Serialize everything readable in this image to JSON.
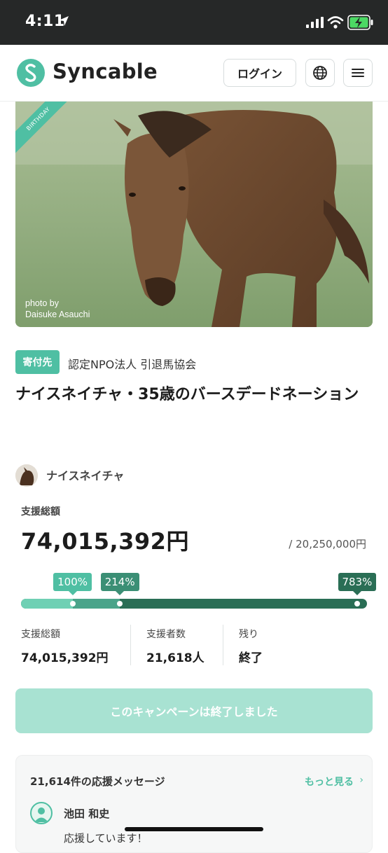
{
  "status_bar": {
    "time": "4:11"
  },
  "header": {
    "brand": "Syncable",
    "login_label": "ログイン"
  },
  "hero": {
    "ribbon_text": "BIRTHDAY",
    "credit_line1": "photo by",
    "credit_line2": "Daisuke Asauchi"
  },
  "campaign": {
    "recipient_tag": "寄付先",
    "recipient_org": "認定NPO法人 引退馬協会",
    "title": "ナイスネイチャ・35歳のバースデードネーション",
    "owner_name": "ナイスネイチャ",
    "total_label": "支援総額",
    "total_amount": "74,015,392円",
    "goal": "/ 20,250,000円",
    "milestones": [
      {
        "label": "100%",
        "fraction": 0.128
      },
      {
        "label": "214%",
        "fraction": 0.273
      },
      {
        "label": "783%",
        "fraction": 1.0
      }
    ],
    "stats": [
      {
        "label": "支援総額",
        "value": "74,015,392円"
      },
      {
        "label": "支援者数",
        "value": "21,618人"
      },
      {
        "label": "残り",
        "value": "終了"
      }
    ],
    "ended_button": "このキャンペーンは終了しました"
  },
  "messages": {
    "count_label": "21,614件の応援メッセージ",
    "more_label": "もっと見る",
    "first": {
      "name": "池田 和史",
      "text": "応援しています！"
    }
  },
  "colors": {
    "brand": "#4fbfa3",
    "bar_dark": "#2a6e55",
    "bar_light": "#6fd0b4",
    "ended_button": "#a8e2d2"
  }
}
